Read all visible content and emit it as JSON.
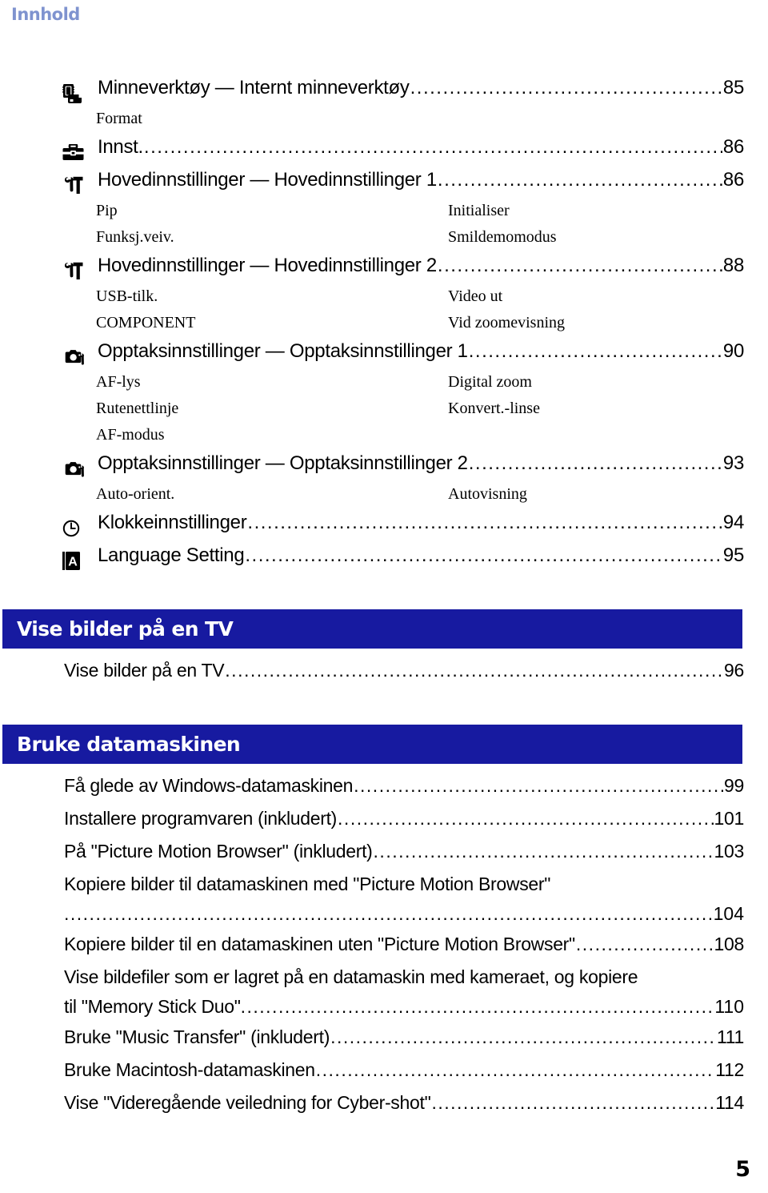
{
  "header": {
    "title": "Innhold"
  },
  "folio": {
    "page_number": "5"
  },
  "colors": {
    "header_blue": "#7f93cf",
    "bar_blue": "#171aa0",
    "text": "#000000",
    "bar_text": "#ffffff"
  },
  "toc": {
    "entries": [
      {
        "icon": "memory-card-icon",
        "title": "Minneverktøy — Internt minneverktøy",
        "page": "85",
        "subs": [
          [
            "Format",
            ""
          ]
        ]
      },
      {
        "icon": "toolbox-icon",
        "title": "Innst.",
        "page": "86",
        "subs": []
      },
      {
        "icon": "wrench-hammer-icon",
        "title": "Hovedinnstillinger — Hovedinnstillinger 1",
        "page": "86",
        "subs": [
          [
            "Pip",
            "Initialiser"
          ],
          [
            "Funksj.veiv.",
            "Smildemomodus"
          ]
        ]
      },
      {
        "icon": "wrench-hammer-icon",
        "title": "Hovedinnstillinger — Hovedinnstillinger 2",
        "page": "88",
        "subs": [
          [
            "USB-tilk.",
            "Video ut"
          ],
          [
            "COMPONENT",
            "Vid zoomevisning"
          ]
        ]
      },
      {
        "icon": "camera-wrench-icon",
        "title": "Opptaksinnstillinger — Opptaksinnstillinger 1",
        "page": "90",
        "subs": [
          [
            "AF-lys",
            "Digital zoom"
          ],
          [
            "Rutenettlinje",
            "Konvert.-linse"
          ],
          [
            "AF-modus",
            ""
          ]
        ]
      },
      {
        "icon": "camera-wrench-icon",
        "title": "Opptaksinnstillinger — Opptaksinnstillinger 2",
        "page": "93",
        "subs": [
          [
            "Auto-orient.",
            "Autovisning"
          ]
        ]
      },
      {
        "icon": "clock-icon",
        "title": "Klokkeinnstillinger",
        "page": "94",
        "subs": []
      },
      {
        "icon": "language-a-icon",
        "title": "Language Setting",
        "page": "95",
        "subs": []
      }
    ]
  },
  "sections": [
    {
      "bar_title": "Vise bilder på en TV",
      "entries": [
        {
          "title": "Vise bilder på en TV",
          "page": "96",
          "wrapped": false
        }
      ]
    },
    {
      "bar_title": "Bruke datamaskinen",
      "entries": [
        {
          "title": "Få glede av Windows-datamaskinen",
          "page": "99",
          "wrapped": false
        },
        {
          "title": "Installere programvaren (inkludert)",
          "page": "101",
          "wrapped": false
        },
        {
          "title": "På \"Picture Motion Browser\" (inkludert)",
          "page": "103",
          "wrapped": false
        },
        {
          "title": "Kopiere bilder til datamaskinen med \"Picture Motion Browser\"",
          "line2": "",
          "page": "104",
          "wrapped": true
        },
        {
          "title": "Kopiere bilder til en datamaskinen uten \"Picture Motion Browser\"",
          "page": "108",
          "wrapped": false
        },
        {
          "title": "Vise bildefiler som er lagret på en datamaskin med kameraet, og kopiere",
          "line2": "til \"Memory Stick Duo\"",
          "page": "110",
          "wrapped": true
        },
        {
          "title": "Bruke \"Music Transfer\" (inkludert)",
          "page": "111",
          "wrapped": false
        },
        {
          "title": "Bruke Macintosh-datamaskinen",
          "page": "112",
          "wrapped": false
        },
        {
          "title": "Vise \"Videregående veiledning for Cyber-shot\"",
          "page": "114",
          "wrapped": false
        }
      ]
    }
  ],
  "leader": "........................................................................................................................"
}
